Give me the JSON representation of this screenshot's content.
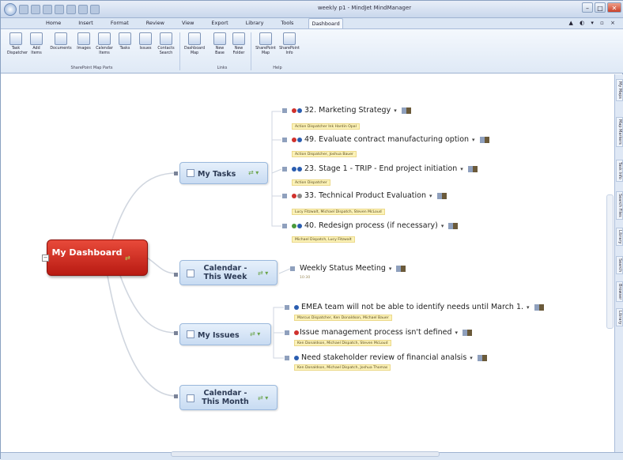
{
  "window": {
    "title": "weekly p1 - MindJet MindManager"
  },
  "ribbon": {
    "tabs": [
      "Home",
      "Insert",
      "Format",
      "Review",
      "View",
      "Export",
      "Library",
      "Tools",
      "Dashboard"
    ],
    "active_tab": "Dashboard",
    "buttons": [
      {
        "label": "Task Dispatcher",
        "icon": "task-dispatcher-icon"
      },
      {
        "label": "Add Items",
        "icon": "add-items-icon"
      },
      {
        "label": "Documents",
        "icon": "documents-icon"
      },
      {
        "label": "Images",
        "icon": "images-icon"
      },
      {
        "label": "Calendar Items",
        "icon": "calendar-icon"
      },
      {
        "label": "Tasks",
        "icon": "tasks-icon"
      },
      {
        "label": "Issues",
        "icon": "issues-icon"
      },
      {
        "label": "Contacts Search",
        "icon": "contacts-icon"
      },
      {
        "label": "Dashboard Map",
        "icon": "dashboard-map-icon"
      },
      {
        "label": "New Base",
        "icon": "new-base-icon"
      },
      {
        "label": "New Folder",
        "icon": "new-folder-icon"
      },
      {
        "label": "SharePoint Map",
        "icon": "sharepoint-map-icon"
      },
      {
        "label": "SharePoint Info",
        "icon": "sharepoint-info-icon"
      }
    ],
    "groups": [
      "SharePoint Map Parts",
      "Links",
      "Help"
    ]
  },
  "right_panel": {
    "tabs": [
      "My Maps",
      "Map Markers",
      "Task Info",
      "Search Files",
      "Library",
      "Search",
      "Browser",
      "Library"
    ]
  },
  "map": {
    "root": "My Dashboard",
    "branches": [
      {
        "label": "My Tasks",
        "items": [
          {
            "text": "32. Marketing Strategy",
            "note": "Action Dispatcher Ink Hardin Opal"
          },
          {
            "text": "49. Evaluate contract manufacturing option",
            "note": "Action Dispatcher, Joshua Bauer"
          },
          {
            "text": "23. Stage 1 - TRIP - End project initiation",
            "note": "Action Dispatcher"
          },
          {
            "text": "33. Technical Product Evaluation",
            "note": "Lucy Fitzwalt, Michael Dispatch, Steven McLoud"
          },
          {
            "text": "40. Redesign process (if necessary)",
            "note": "Michael Dispatch, Lucy Fitzwalt"
          }
        ]
      },
      {
        "label": "Calendar - This Week",
        "items": [
          {
            "text": "Weekly Status Meeting",
            "note": "10:30"
          }
        ]
      },
      {
        "label": "My Issues",
        "items": [
          {
            "text": "EMEA team will not be able to identify needs until March 1.",
            "note": "Marcus Dispatcher, Ken Donaldson, Michael Bauer"
          },
          {
            "text": "Issue management process isn't defined",
            "note": "Ken Donaldson, Michael Dispatch, Steven McLoud"
          },
          {
            "text": "Need stakeholder review of financial analsis",
            "note": "Ken Donaldson, Michael Dispatch, Joshua Thomas"
          }
        ]
      },
      {
        "label": "Calendar - This Month",
        "items": []
      }
    ]
  }
}
